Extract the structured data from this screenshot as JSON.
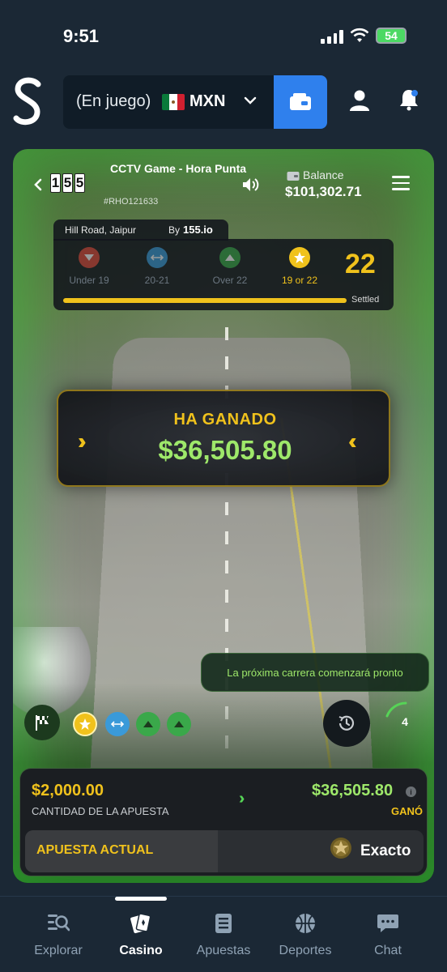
{
  "status_bar": {
    "time": "9:51",
    "battery": "54"
  },
  "header": {
    "status_text": "(En juego)",
    "currency": "MXN",
    "icons": [
      "logo-s-icon",
      "flag-mexico-icon",
      "chevron-down-icon",
      "wallet-icon",
      "user-icon",
      "bell-icon"
    ]
  },
  "game": {
    "logo_digits": [
      "1",
      "5",
      "5"
    ],
    "title": "CCTV Game - Hora Punta",
    "round_id": "#RHO121633",
    "balance_label": "Balance",
    "balance_value": "$101,302.71",
    "location": "Hill Road, Jaipur",
    "by_label": "By",
    "brand": "155.io",
    "options": [
      {
        "label": "Under 19",
        "icon": "arrow-down-icon",
        "color": "#e04a3a",
        "active": false
      },
      {
        "label": "20-21",
        "icon": "arrows-horizontal-icon",
        "color": "#3a9ad9",
        "active": false
      },
      {
        "label": "Over 22",
        "icon": "arrow-up-icon",
        "color": "#3aa84a",
        "active": false
      },
      {
        "label": "19 or 22",
        "icon": "star-icon",
        "color": "#f0c21c",
        "active": true
      }
    ],
    "result": "22",
    "progress_status": "Settled",
    "progress_fraction": 1,
    "win_label": "HA GANADO",
    "win_amount": "$36,505.80",
    "next_race": "La próxima carrera comenzará pronto",
    "history": [
      {
        "icon": "star-icon",
        "color": "#f0c21c"
      },
      {
        "icon": "arrows-horizontal-icon",
        "color": "#3a9ad9"
      },
      {
        "icon": "arrow-up-icon",
        "color": "#3aa84a"
      },
      {
        "icon": "arrow-up-icon",
        "color": "#3aa84a"
      }
    ],
    "countdown": "4"
  },
  "bet": {
    "stake_value": "$2,000.00",
    "stake_label": "CANTIDAD DE LA APUESTA",
    "won_value": "$36,505.80",
    "won_label": "GANÓ",
    "current_label": "APUESTA ACTUAL",
    "current_value": "Exacto"
  },
  "nav": {
    "items": [
      {
        "label": "Explorar",
        "icon": "explore-icon"
      },
      {
        "label": "Casino",
        "icon": "cards-icon",
        "active": true
      },
      {
        "label": "Apuestas",
        "icon": "bets-list-icon"
      },
      {
        "label": "Deportes",
        "icon": "basketball-icon"
      },
      {
        "label": "Chat",
        "icon": "chat-icon"
      }
    ]
  },
  "colors": {
    "accent": "#2f80ed",
    "gold": "#f0c21c",
    "win_green": "#9ee86a",
    "background": "#1b2835"
  }
}
